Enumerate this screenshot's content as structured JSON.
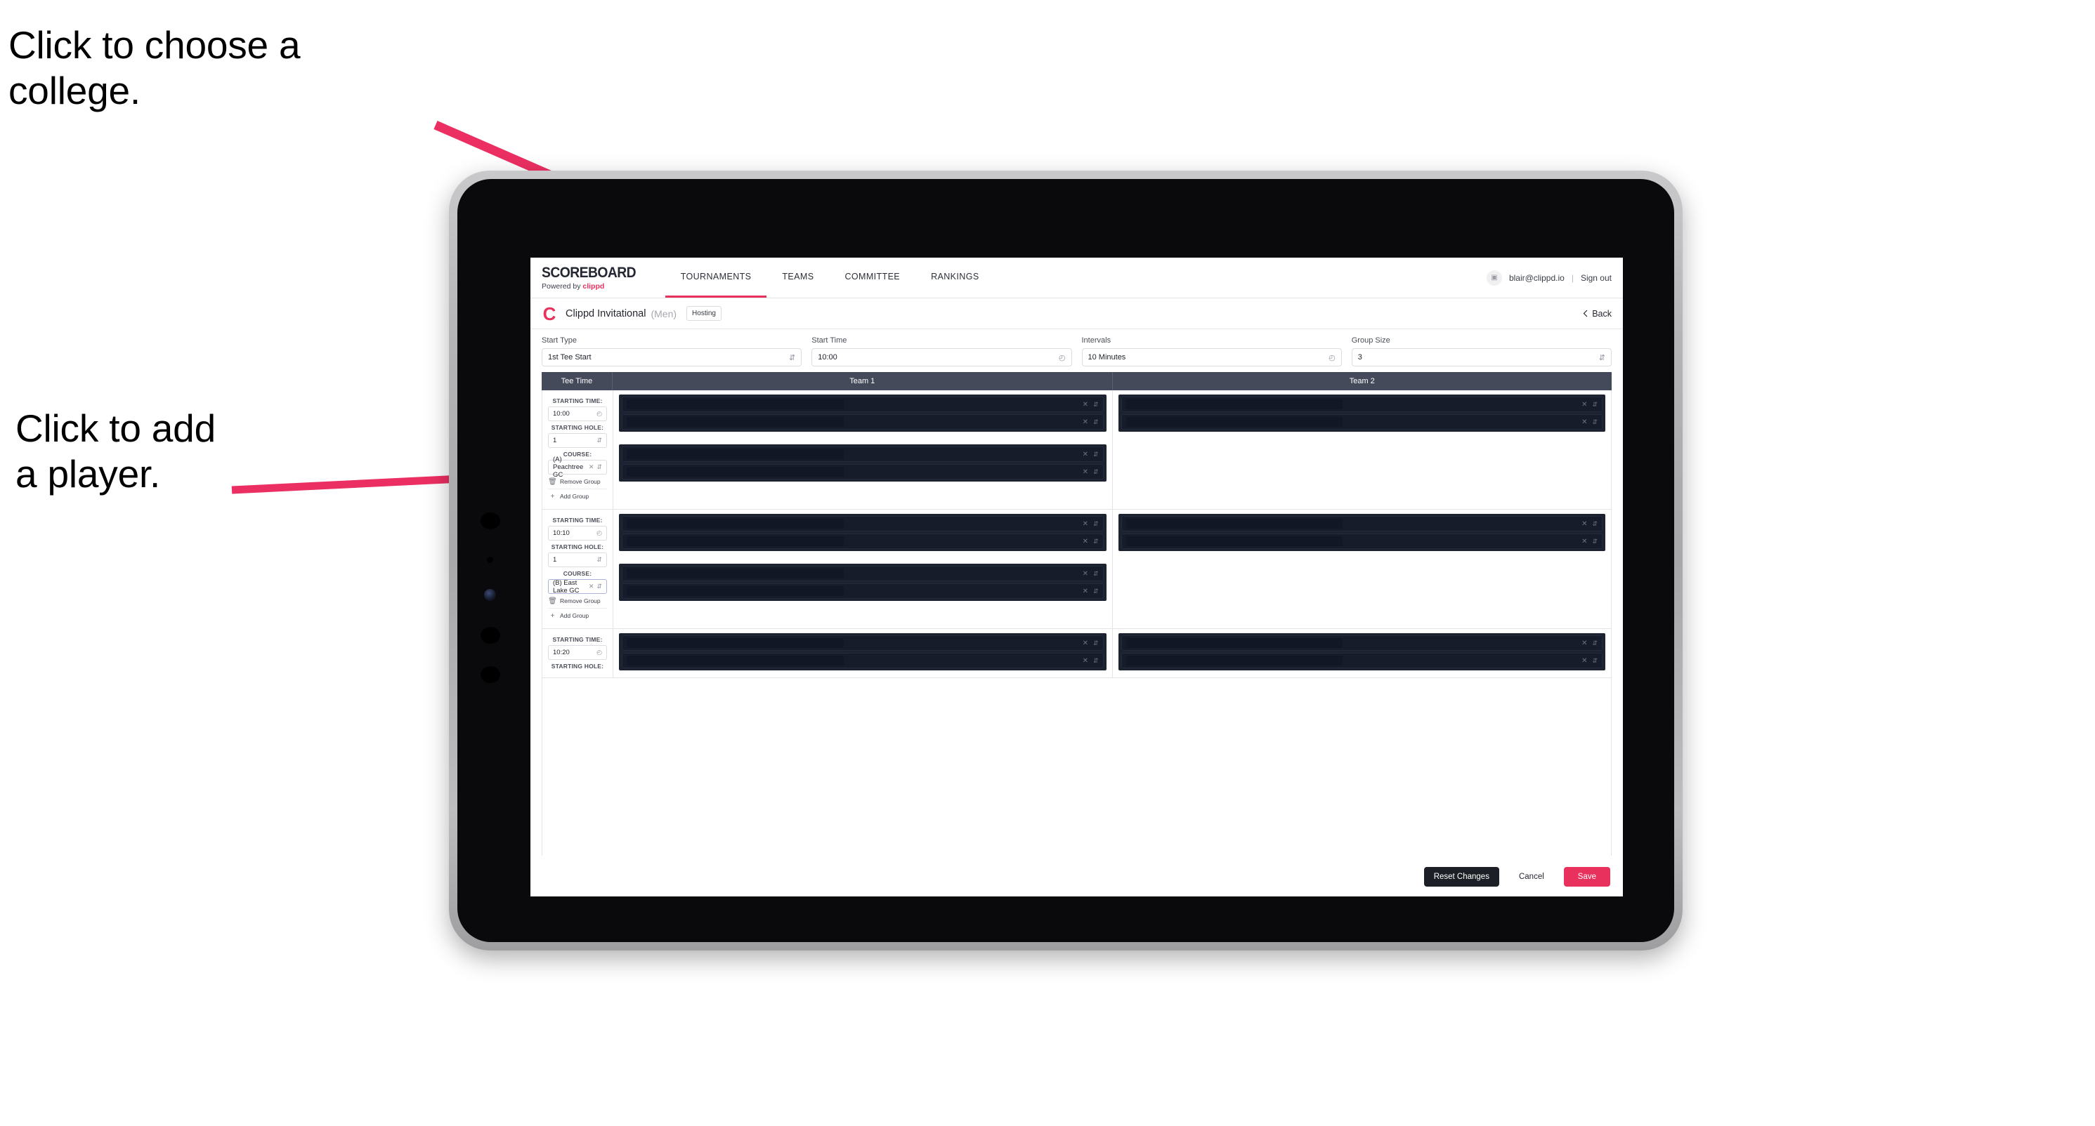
{
  "annotations": {
    "college": "Click to choose a\ncollege.",
    "player": "Click to add\na player."
  },
  "colors": {
    "accent": "#e8315c",
    "header_bar": "#454a5b",
    "dark": "#1c1f26"
  },
  "topnav": {
    "brand_title": "SCOREBOARD",
    "brand_sub_prefix": "Powered by ",
    "brand_sub_accent": "clippd",
    "tabs": [
      {
        "label": "TOURNAMENTS",
        "active": true
      },
      {
        "label": "TEAMS",
        "active": false
      },
      {
        "label": "COMMITTEE",
        "active": false
      },
      {
        "label": "RANKINGS",
        "active": false
      }
    ],
    "avatar_icon": "user-avatar-icon",
    "email": "blair@clippd.io",
    "separator": "|",
    "sign_out": "Sign out"
  },
  "tournament_bar": {
    "logo_glyph": "C",
    "name": "Clippd Invitational",
    "gender": "(Men)",
    "badge": "Hosting",
    "back_label": "Back",
    "back_icon": "chevron-left-icon"
  },
  "filters": [
    {
      "label": "Start Type",
      "value": "1st Tee Start",
      "adorn": "stepper-icon"
    },
    {
      "label": "Start Time",
      "value": "10:00",
      "adorn": "clock-icon"
    },
    {
      "label": "Intervals",
      "value": "10 Minutes",
      "adorn": "clock-icon"
    },
    {
      "label": "Group Size",
      "value": "3",
      "adorn": "stepper-icon"
    }
  ],
  "table": {
    "headers": [
      "Tee Time",
      "Team 1",
      "Team 2"
    ],
    "labels": {
      "starting_time": "STARTING TIME:",
      "starting_hole": "STARTING HOLE:",
      "course": "COURSE:",
      "remove_group": "Remove Group",
      "add_group": "Add Group",
      "remove_icon": "trash-icon",
      "add_icon": "plus-icon",
      "clear_icon": "clear-x-icon",
      "stepper_icon": "stepper-icon",
      "clock_icon": "clock-icon"
    },
    "rows": [
      {
        "starting_time": "10:00",
        "starting_hole": "1",
        "course": "(A) Peachtree GC",
        "course_focused": false,
        "team1_groups": [
          2,
          2
        ],
        "team2_groups": [
          2
        ]
      },
      {
        "starting_time": "10:10",
        "starting_hole": "1",
        "course": "(B) East Lake GC",
        "course_focused": true,
        "team1_groups": [
          2,
          2
        ],
        "team2_groups": [
          2
        ]
      },
      {
        "starting_time": "10:20",
        "starting_hole": "",
        "course": "",
        "course_focused": false,
        "team1_groups": [
          2
        ],
        "team2_groups": [
          2
        ]
      }
    ]
  },
  "footer": {
    "reset": "Reset Changes",
    "cancel": "Cancel",
    "save": "Save"
  }
}
